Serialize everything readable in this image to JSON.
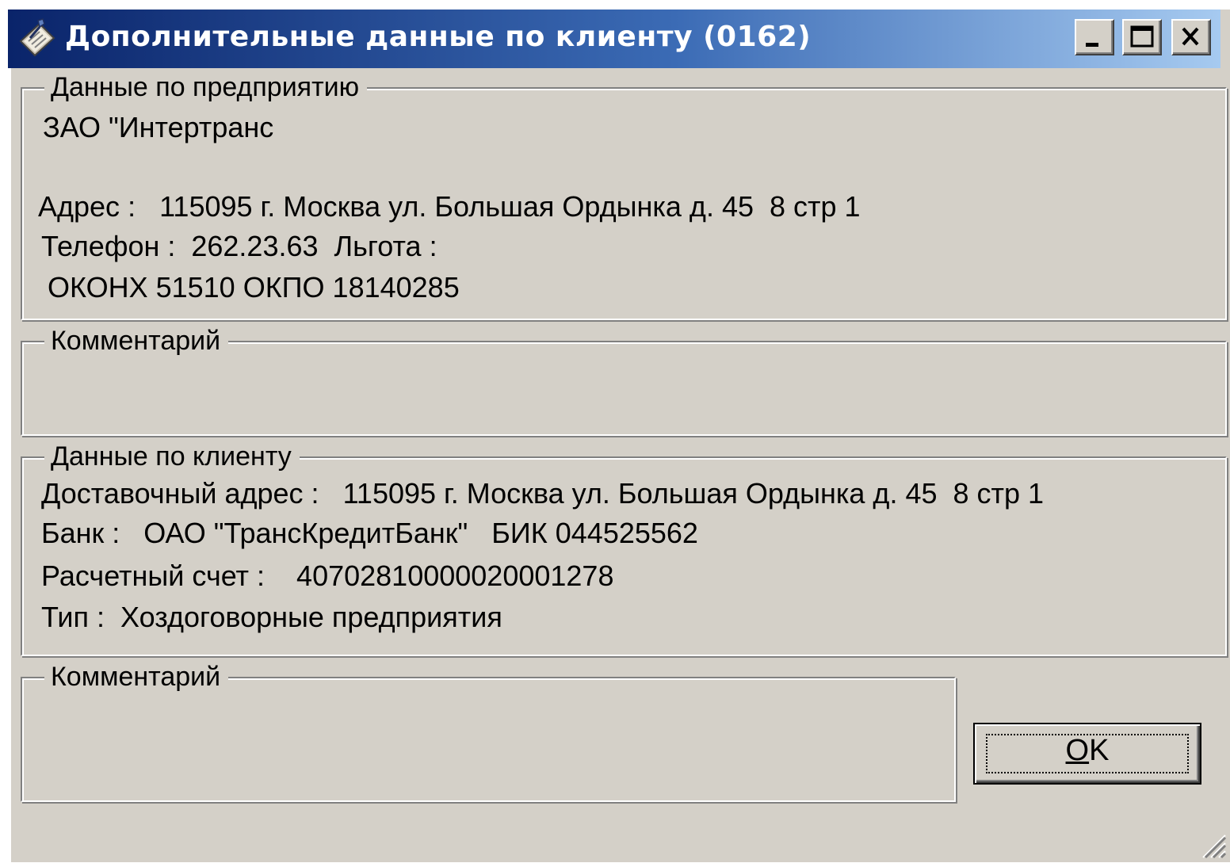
{
  "window": {
    "title": "Дополнительные данные по клиенту (0162)",
    "icon": "notebook-pen-icon",
    "controls": {
      "minimize": "minimize-icon",
      "maximize": "maximize-icon",
      "close": "close-icon"
    }
  },
  "enterprise": {
    "legend": "Данные по предприятию",
    "name": "ЗАО \"Интертранс",
    "address_line": "Адрес :   115095 г. Москва ул. Большая Ордынка д. 45  8 стр 1",
    "phone_line": "Телефон :  262.23.63  Льгота :",
    "codes_line": "ОКОНХ 51510 ОКПО 18140285"
  },
  "enterprise_comment": {
    "legend": "Комментарий",
    "text": ""
  },
  "client": {
    "legend": "Данные по клиенту",
    "delivery_line": "Доставочный адрес :   115095 г. Москва ул. Большая Ордынка д. 45  8 стр 1",
    "bank_line": "Банк :   ОАО \"ТрансКредитБанк\"   БИК 044525562",
    "account_line": "Расчетный счет :    40702810000020001278",
    "type_line": "Тип :  Хоздоговорные предприятия"
  },
  "client_comment": {
    "legend": "Комментарий",
    "text": ""
  },
  "buttons": {
    "ok_mnemonic": "O",
    "ok_rest": "K"
  },
  "colors": {
    "face": "#d4d0c8",
    "title_start": "#0a246a",
    "title_end": "#a6caf0"
  }
}
